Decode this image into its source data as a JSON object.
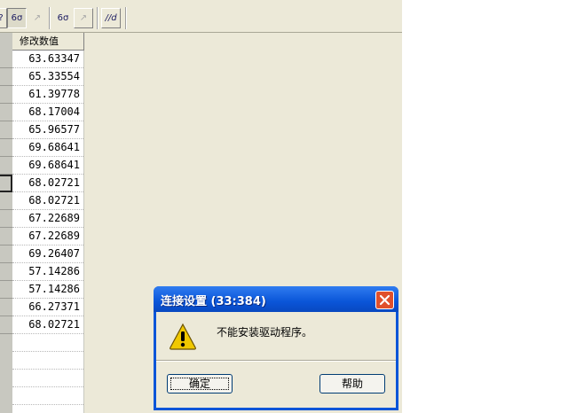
{
  "toolbar": {
    "buttons": [
      {
        "name": "pointer-button",
        "label": "?"
      },
      {
        "name": "glasses-view-button",
        "label": "6σ"
      },
      {
        "name": "revert-button",
        "label": "↗"
      },
      {
        "name": "glasses-edit-button",
        "label": "6σ"
      },
      {
        "name": "restore-button",
        "label": "↗"
      },
      {
        "name": "chart-button",
        "label": "//d"
      }
    ]
  },
  "grid": {
    "column_header": "修改数值",
    "values": [
      "63.63347",
      "65.33554",
      "61.39778",
      "68.17004",
      "65.96577",
      "69.68641",
      "69.68641",
      "68.02721",
      "68.02721",
      "67.22689",
      "67.22689",
      "69.26407",
      "57.14286",
      "57.14286",
      "66.27371",
      "68.02721",
      "",
      "",
      "",
      "",
      ""
    ]
  },
  "dialog": {
    "title": "连接设置 (33:384)",
    "message": "不能安装驱动程序。",
    "ok_label": "确定",
    "help_label": "帮助",
    "icon": "warning-icon",
    "colors": {
      "title_bar": "#0a55d8",
      "close_button": "#e0502c",
      "warning": "#f0c800"
    }
  }
}
